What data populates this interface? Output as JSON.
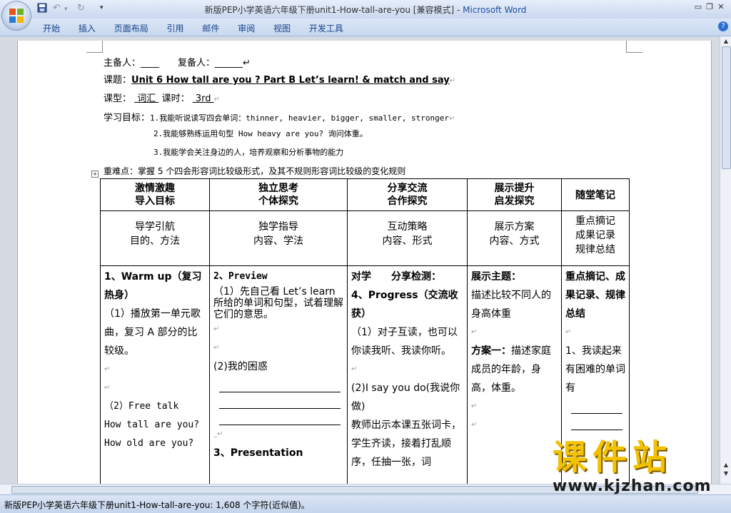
{
  "window": {
    "title": "新版PEP小学英语六年级下册unit1-How-tall-are-you [兼容模式] - ",
    "app_name": "Microsoft Word"
  },
  "quick_access": {
    "save_icon": "save-icon",
    "undo_icon": "undo-icon",
    "redo_icon": "redo-icon",
    "more": "▾"
  },
  "window_controls": {
    "minimize": "▭",
    "restore": "❐",
    "close": "✕"
  },
  "ribbon": {
    "tabs": [
      "开始",
      "插入",
      "页面布局",
      "引用",
      "邮件",
      "审阅",
      "视图",
      "开发工具"
    ],
    "help": "?"
  },
  "doc": {
    "preparer": "主备人：____　　复备人：______↵",
    "topic_label": "课题：",
    "topic_value": "Unit 6 How tall are you ? Part B Let’s learn! & match and say",
    "type_label": "课型：",
    "type_value": "词汇",
    "period_label": "课时：",
    "period_value": "3rd",
    "goal_label": "学习目标：",
    "goal1": "1.我能听说读写四会单词：thinner, heavier, bigger, smaller, stronger",
    "goal2": "2.我能够熟练运用句型 How heavy are you? 询问体重。",
    "goal3": "3.我能学会关注身边的人，培养观察和分析事物的能力",
    "key_points": "重难点：掌握 5 个四会形容词比较级形式，及其不规则形容词比较级的变化规则",
    "table": {
      "header1": [
        {
          "l1": "激情激趣",
          "l2": "导入目标"
        },
        {
          "l1": "独立思考",
          "l2": "个体探究"
        },
        {
          "l1": "分享交流",
          "l2": "合作探究"
        },
        {
          "l1": "展示提升",
          "l2": "启发探究"
        },
        {
          "l1": "随堂笔记",
          "l2": ""
        }
      ],
      "header2": [
        {
          "l1": "导学引航",
          "l2": "目的、方法",
          "l3": ""
        },
        {
          "l1": "独学指导",
          "l2": "内容、学法",
          "l3": ""
        },
        {
          "l1": "互动策略",
          "l2": "内容、形式",
          "l3": ""
        },
        {
          "l1": "展示方案",
          "l2": "内容、方式",
          "l3": ""
        },
        {
          "l1": "重点摘记",
          "l2": "成果记录",
          "l3": "规律总结"
        }
      ],
      "col1": {
        "a": "1、Warm up（复习热身）",
        "b": "（1）播放第一单元歌曲，复习 A 部分的比较级。",
        "c": "（2）Free talk",
        "d": "How tall are you?",
        "e": "How old are you?"
      },
      "col2": {
        "a": "2、Preview",
        "b": "（1）先自己看 Let’s learn 所给的单词和句型，试着理解它们的意思。",
        "c": "(2)我的困惑",
        "d": "3、Presentation"
      },
      "col3": {
        "a": "对学　　分享检测：",
        "b": "4、Progress（交流收获）",
        "c": "（1）对子互读，也可以你读我听、我读你听。",
        "d": "(2)I say you do(我说你做)",
        "e": "教师出示本课五张词卡，学生齐读，接着打乱顺序，任抽一张，词"
      },
      "col4": {
        "a": "展示主题：",
        "b": "描述比较不同人的身高体重",
        "c": "方案一：",
        "d": "描述家庭成员的年龄，身高，体重。"
      },
      "col5": {
        "a": "重点摘记、成果记录、规律总结",
        "b": "1、我读起来有困难的单词有"
      }
    }
  },
  "status": {
    "text": "新版PEP小学英语六年级下册unit1-How-tall-are-you: 1,608 个字符(近似值)。"
  },
  "watermark": {
    "big": "课件站",
    "url": "www.kjzhan.com"
  }
}
